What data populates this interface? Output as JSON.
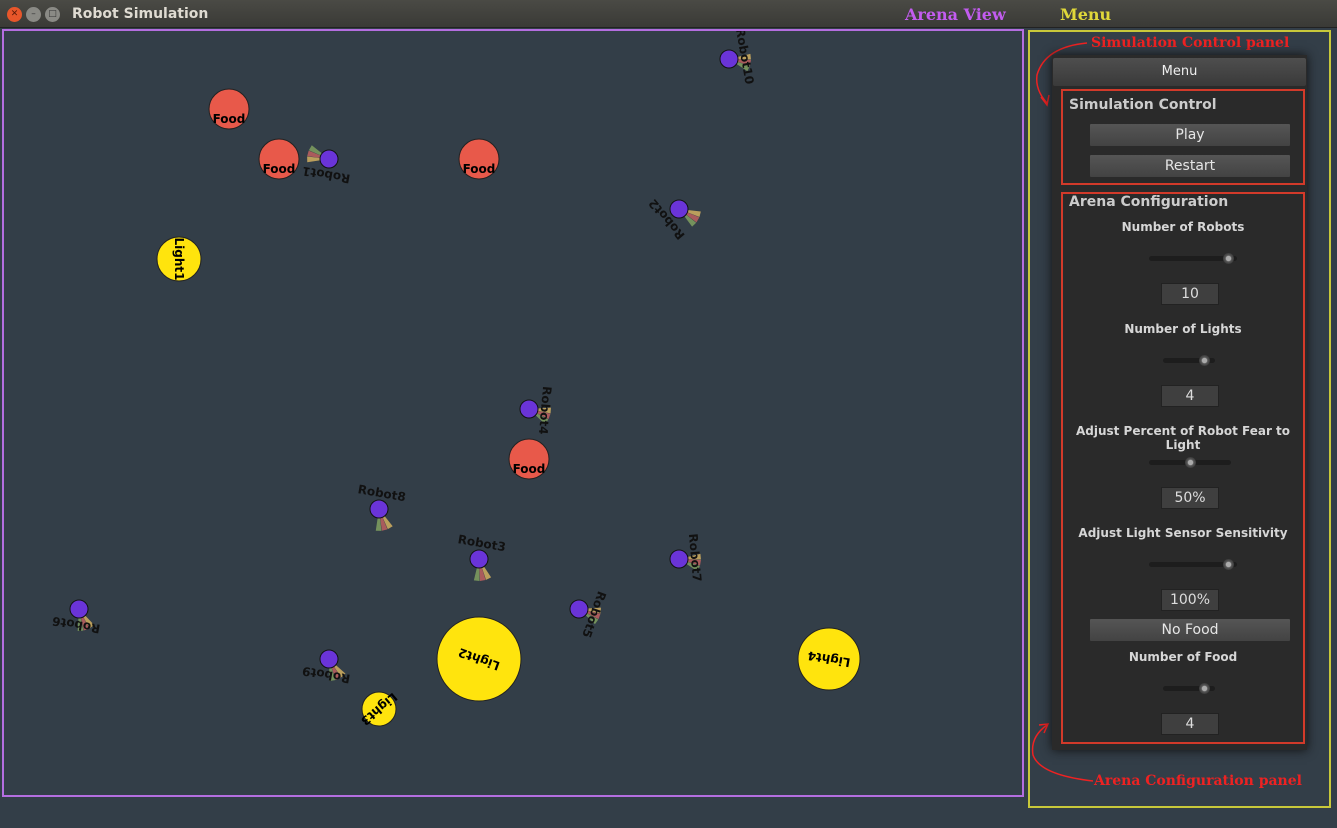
{
  "window": {
    "title": "Robot Simulation"
  },
  "annotations": {
    "arena_view": "Arena View",
    "menu": "Menu",
    "sim_control_panel": "Simulation Control panel",
    "arena_config_panel": "Arena Configuration panel"
  },
  "colors": {
    "food": "#e8594a",
    "light": "#ffe40d",
    "robot": "#6a34d8",
    "arena_bg": "#333e48",
    "arena_border": "#b46ee0",
    "menu_border": "#c8c83a",
    "section_border": "#d23a2a"
  },
  "menu": {
    "button_label": "Menu",
    "sim_control": {
      "title": "Simulation Control",
      "play_label": "Play",
      "restart_label": "Restart"
    },
    "arena_config": {
      "title": "Arena Configuration",
      "num_robots": {
        "label": "Number of Robots",
        "value": "10",
        "slider_fraction": 0.9
      },
      "num_lights": {
        "label": "Number of Lights",
        "value": "4",
        "slider_fraction": 0.8
      },
      "fear_percent": {
        "label": "Adjust Percent of Robot Fear to Light",
        "value": "50%",
        "slider_fraction": 0.5
      },
      "sensor_sensitivity": {
        "label": "Adjust Light Sensor Sensitivity",
        "value": "100%",
        "slider_fraction": 0.9
      },
      "food_toggle_label": "No Food",
      "num_food": {
        "label": "Number of Food",
        "value": "4",
        "slider_fraction": 0.8
      }
    }
  },
  "arena": {
    "foods": [
      {
        "label": "Food"
      },
      {
        "label": "Food"
      },
      {
        "label": "Food"
      },
      {
        "label": "Food"
      }
    ],
    "lights": [
      {
        "label": "Light1"
      },
      {
        "label": "Light2"
      },
      {
        "label": "Light3"
      },
      {
        "label": "Light4"
      }
    ],
    "robots": [
      {
        "label": "Robot1"
      },
      {
        "label": "Robot2"
      },
      {
        "label": "Robot3"
      },
      {
        "label": "Robot4"
      },
      {
        "label": "Robot5"
      },
      {
        "label": "Robot6"
      },
      {
        "label": "Robot7"
      },
      {
        "label": "Robot8"
      },
      {
        "label": "Robot9"
      },
      {
        "label": "Robot10"
      }
    ]
  }
}
